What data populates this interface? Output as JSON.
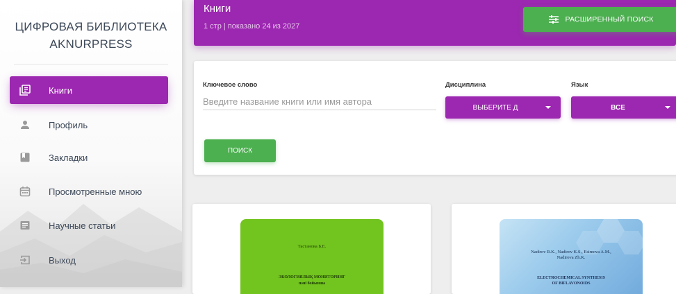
{
  "sidebar": {
    "brand_line1": "ЦИФРОВАЯ БИБЛИОТЕКА",
    "brand_line2": "AKNURPRESS",
    "items": [
      {
        "label": "Книги",
        "icon": "library-books-icon",
        "active": true
      },
      {
        "label": "Профиль",
        "icon": "person-icon",
        "active": false
      },
      {
        "label": "Закладки",
        "icon": "bookmark-icon",
        "active": false
      },
      {
        "label": "Просмотренные мною",
        "icon": "calendar-icon",
        "active": false
      },
      {
        "label": "Научные статьи",
        "icon": "article-icon",
        "active": false
      },
      {
        "label": "Выход",
        "icon": "logout-icon",
        "active": false
      }
    ]
  },
  "header": {
    "title": "Книги",
    "subtitle": "1 стр | показано 24 из 2027",
    "advanced_search_label": "РАСШИРЕННЫЙ ПОИСК",
    "advanced_search_icon": "tune-icon"
  },
  "search": {
    "keyword_label": "Ключевое слово",
    "keyword_placeholder": "Введите название книги или имя автора",
    "keyword_value": "",
    "discipline_label": "Дисциплина",
    "discipline_value": "ВЫБЕРИТЕ Д",
    "language_label": "Язык",
    "language_value": "ВСЕ",
    "search_button_label": "ПОИСК"
  },
  "books": [
    {
      "author": "Тастанова Б.Е.",
      "title_line1": "ЭКОЛОГИЯЛЫҚ МОНИТОРИНГ",
      "title_line2": "пәні бойынша"
    },
    {
      "author_line1": "Nadirov R.K., Nadirov K.S., Esimova A.M.,",
      "author_line2": "Nadirova Zh.K.",
      "title_line1": "ELECTROCHEMICAL SYNTHESIS",
      "title_line2": "OF BIFLAVONOIDS"
    }
  ],
  "colors": {
    "primary": "#9c27b0",
    "success": "#4caf50",
    "background": "#eeeeee"
  }
}
